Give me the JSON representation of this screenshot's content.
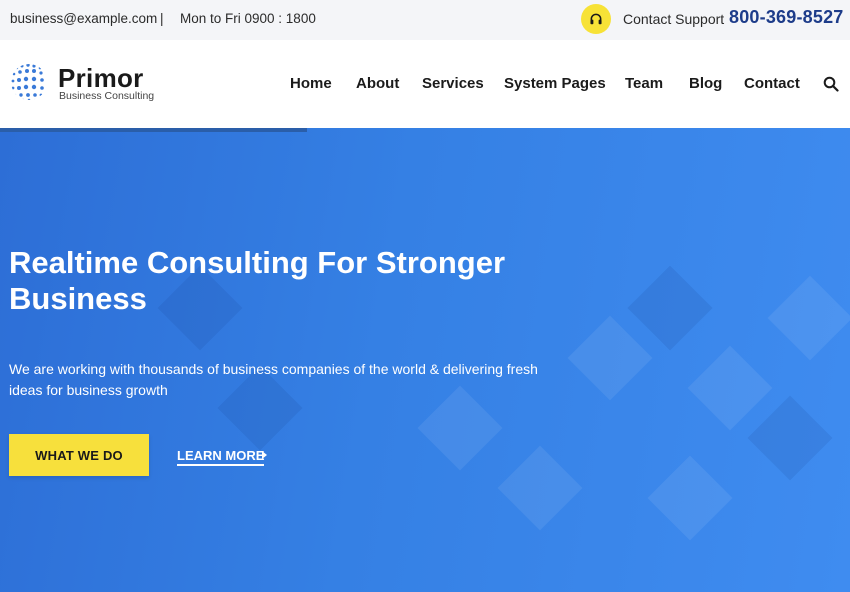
{
  "topbar": {
    "email": "business@example.com",
    "separator": "|",
    "hours": "Mon to Fri 0900 : 1800",
    "support_label": "Contact Support",
    "phone": "800-369-8527"
  },
  "brand": {
    "name": "Primor",
    "tagline": "Business Consulting"
  },
  "nav": {
    "items": [
      {
        "label": "Home"
      },
      {
        "label": "About"
      },
      {
        "label": "Services"
      },
      {
        "label": "System Pages"
      },
      {
        "label": "Team"
      },
      {
        "label": "Blog"
      },
      {
        "label": "Contact"
      }
    ]
  },
  "hero": {
    "title": "Realtime Consulting For Stronger Business",
    "subtitle": "We are working with thousands of business companies of the world & delivering fresh ideas for business growth",
    "primary_button": "WHAT WE DO",
    "secondary_link": "LEARN MORE"
  },
  "icons": {
    "support": "headphones-icon",
    "search": "search-icon",
    "logo": "globe-icon",
    "link_arrow": "caret-right-icon"
  },
  "colors": {
    "accent_yellow": "#f7e03c",
    "phone_blue": "#1d3c8a",
    "hero_blue": "#3580e4"
  }
}
